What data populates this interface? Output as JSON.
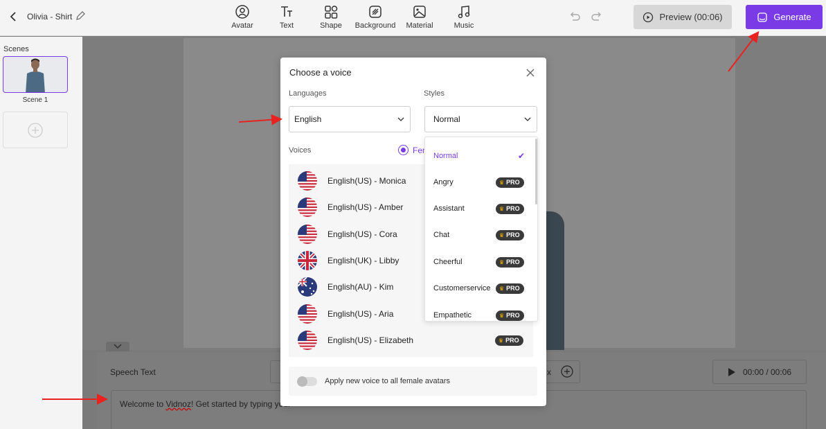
{
  "topbar": {
    "project_title": "Olivia - Shirt",
    "tools": [
      "Avatar",
      "Text",
      "Shape",
      "Background",
      "Material",
      "Music"
    ],
    "preview_label": "Preview (00:06)",
    "generate_label": "Generate"
  },
  "scenes": {
    "title": "Scenes",
    "items": [
      {
        "label": "Scene 1"
      }
    ]
  },
  "speech": {
    "label": "Speech Text",
    "speed": "x",
    "time": "00:00 / 00:06",
    "text_before": "Welcome to ",
    "text_brand": "Vidnoz",
    "text_after": "! Get started by typing your"
  },
  "modal": {
    "title": "Choose a voice",
    "languages_label": "Languages",
    "styles_label": "Styles",
    "language_value": "English",
    "style_value": "Normal",
    "voices_label": "Voices",
    "gender_option": "Female",
    "voices": [
      {
        "name": "English(US) - Monica",
        "flag": "us",
        "pro": false
      },
      {
        "name": "English(US) - Amber",
        "flag": "us",
        "pro": false
      },
      {
        "name": "English(US) - Cora",
        "flag": "us",
        "pro": false
      },
      {
        "name": "English(UK) - Libby",
        "flag": "uk",
        "pro": false
      },
      {
        "name": "English(AU) - Kim",
        "flag": "au",
        "pro": false
      },
      {
        "name": "English(US) - Aria",
        "flag": "us",
        "pro": false
      },
      {
        "name": "English(US) - Elizabeth",
        "flag": "us",
        "pro": true
      }
    ],
    "apply_text": "Apply new voice to all female avatars",
    "pro_label": "PRO"
  },
  "styles_dropdown": {
    "items": [
      {
        "label": "Normal",
        "selected": true,
        "pro": false
      },
      {
        "label": "Angry",
        "selected": false,
        "pro": true
      },
      {
        "label": "Assistant",
        "selected": false,
        "pro": true
      },
      {
        "label": "Chat",
        "selected": false,
        "pro": true
      },
      {
        "label": "Cheerful",
        "selected": false,
        "pro": true
      },
      {
        "label": "Customerservice",
        "selected": false,
        "pro": true
      },
      {
        "label": "Empathetic",
        "selected": false,
        "pro": true
      }
    ]
  },
  "colors": {
    "accent": "#7a3be6",
    "arrow": "#e8231f"
  }
}
